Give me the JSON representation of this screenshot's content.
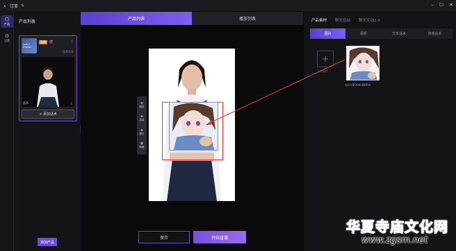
{
  "window": {
    "title": "订单",
    "edit_icon": "pencil-icon",
    "back_icon": "chevron-left-icon"
  },
  "rail": {
    "items": [
      {
        "label": "产品",
        "icon": "cube-icon"
      },
      {
        "label": "设置",
        "icon": "gear-icon"
      }
    ]
  },
  "left": {
    "header": "产品列表",
    "product": {
      "thumb_text": "Learn English",
      "badge": "直播",
      "name": "仿",
      "sub": "话术文本",
      "menu": "⋮"
    },
    "speech": {
      "label": "话术",
      "num": "1"
    },
    "add_speech": "+ 添加话术",
    "add_product": "添加产品"
  },
  "center": {
    "tabs": [
      {
        "label": "产品列表",
        "active": true
      },
      {
        "label": "播放列表",
        "active": false
      }
    ],
    "toolbar": [
      {
        "label": "图层",
        "icon": "layers-icon"
      },
      {
        "label": "层级",
        "icon": "stack-icon"
      },
      {
        "label": "图片",
        "icon": "image-icon"
      },
      {
        "label": "隐藏",
        "icon": "eye-icon"
      }
    ],
    "save": "保存",
    "start_live": "开始直播"
  },
  "right": {
    "tabs": [
      {
        "label": "产品素材",
        "active": true
      },
      {
        "label": "聊天互动",
        "active": false
      },
      {
        "label": "聊天互动2.0",
        "active": false
      }
    ],
    "subtabs": [
      {
        "label": "图片",
        "active": true
      },
      {
        "label": "视频",
        "active": false
      },
      {
        "label": "文本话术",
        "active": false
      },
      {
        "label": "商城话术",
        "active": false
      }
    ],
    "upload_label": "上传图片",
    "thumb_name": "ba7c8f29dc6891e"
  },
  "watermark": {
    "cn": "华夏寺庙文化网",
    "url": "www.zgsm.net"
  },
  "colors": {
    "accent": "#6b4bd8",
    "annotation_red": "#e53935"
  }
}
